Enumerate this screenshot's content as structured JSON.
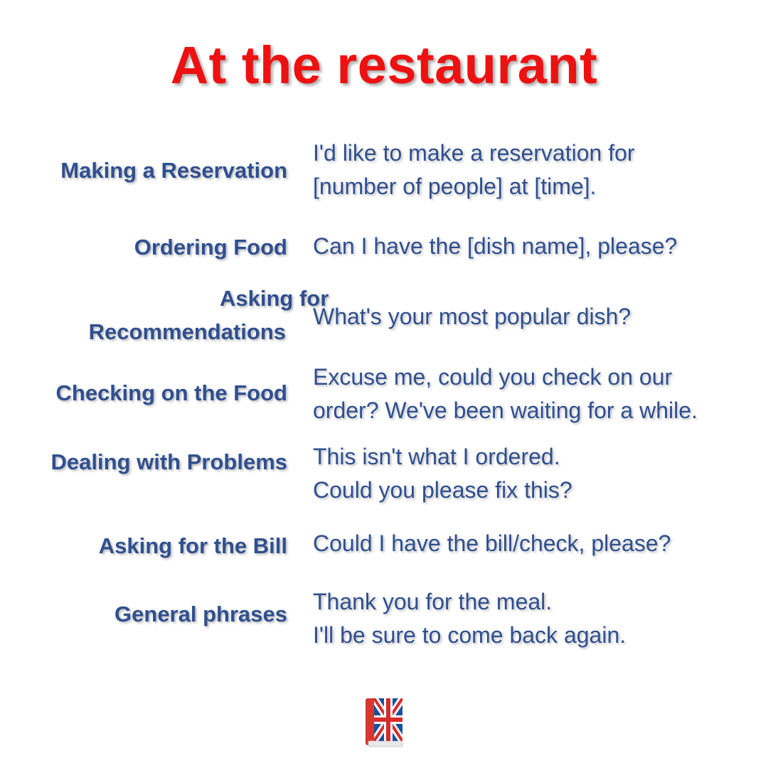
{
  "title": "At the restaurant",
  "rows": [
    {
      "label_lines": [
        "Making a Reservation"
      ],
      "phrase_lines": [
        "I'd like to make a reservation for",
        "[number of people] at [time]."
      ]
    },
    {
      "label_lines": [
        "Ordering Food"
      ],
      "phrase_lines": [
        "Can I have the [dish name], please?"
      ]
    },
    {
      "label_lines": [
        "Asking for",
        "Recommendations"
      ],
      "phrase_lines": [
        "What's your most popular dish?"
      ]
    },
    {
      "label_lines": [
        "Checking on the Food"
      ],
      "phrase_lines": [
        "Excuse me, could you check on our",
        "order? We've been waiting for a while."
      ]
    },
    {
      "label_lines": [
        "Dealing with Problems"
      ],
      "phrase_lines": [
        "This isn't what I ordered.",
        "Could you please fix this?"
      ]
    },
    {
      "label_lines": [
        "Asking for the Bill"
      ],
      "phrase_lines": [
        "Could I have the bill/check, please?"
      ]
    },
    {
      "label_lines": [
        "General phrases"
      ],
      "phrase_lines": [
        "Thank you for the meal.",
        "I'll be sure to come back again."
      ]
    }
  ],
  "colors": {
    "title": "#ee1111",
    "text": "#2f4f8f",
    "flag_blue": "#1f4f9a",
    "flag_red": "#d62b2b",
    "book_red": "#d9362f"
  },
  "logo_icon": "book-union-jack-icon"
}
